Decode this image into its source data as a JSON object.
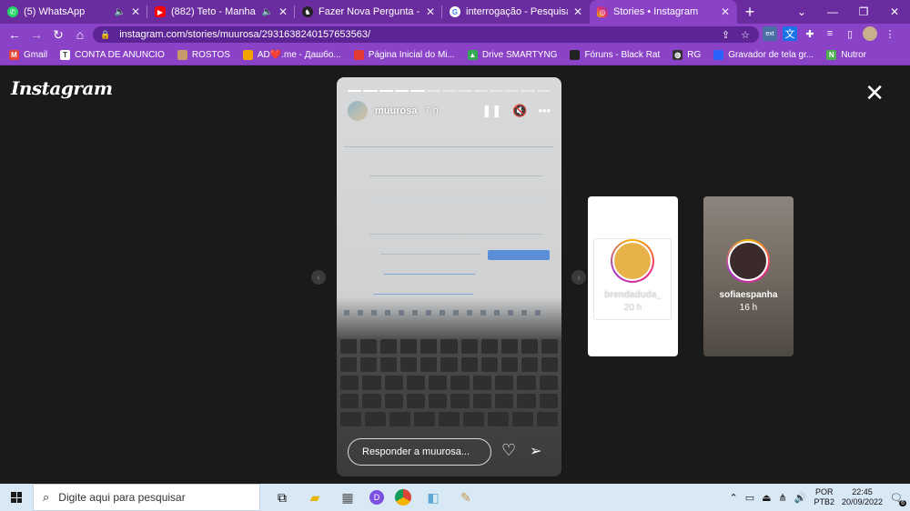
{
  "tabs": [
    {
      "title": "(5) WhatsApp",
      "favicon": "whatsapp-icon",
      "color": "#25d366",
      "muted": true
    },
    {
      "title": "(882) Teto - Manha - You",
      "favicon": "youtube-icon",
      "color": "#ff0000",
      "muted": true
    },
    {
      "title": "Fazer Nova Pergunta - Black",
      "favicon": "blackrat-icon",
      "color": "#222222",
      "muted": false
    },
    {
      "title": "interrogação - Pesquisa Goo",
      "favicon": "google-icon",
      "color": "#ffffff",
      "muted": false
    },
    {
      "title": "Stories • Instagram",
      "favicon": "instagram-icon",
      "color": "#e1306c",
      "muted": false
    }
  ],
  "address": {
    "url": "instagram.com/stories/muurosa/2931638240157653563/"
  },
  "bookmarks": [
    {
      "label": "Gmail",
      "icon": "gmail-icon",
      "color": "#ea4335",
      "glyph": "M"
    },
    {
      "label": "CONTA DE ANUNCIO",
      "icon": "t-icon",
      "color": "#ffffff",
      "glyph": "T"
    },
    {
      "label": "ROSTOS",
      "icon": "avatar-icon",
      "color": "#c99a6b",
      "glyph": ""
    },
    {
      "label": "AD❤️.me - Дашбо...",
      "icon": "ad-icon",
      "color": "#f5a300",
      "glyph": ""
    },
    {
      "label": "Página Inicial do Mi...",
      "icon": "mi-icon",
      "color": "#e53935",
      "glyph": ""
    },
    {
      "label": "Drive SMARTYNG",
      "icon": "drive-icon",
      "color": "#34a853",
      "glyph": "▲"
    },
    {
      "label": "Fóruns - Black Rat",
      "icon": "blackrat-icon",
      "color": "#222222",
      "glyph": ""
    },
    {
      "label": "RG",
      "icon": "globe-icon",
      "color": "#333333",
      "glyph": "◍"
    },
    {
      "label": "Gravador de tela gr...",
      "icon": "recorder-icon",
      "color": "#2962ff",
      "glyph": ""
    },
    {
      "label": "Nutror",
      "icon": "nutror-icon",
      "color": "#4caf50",
      "glyph": "N"
    }
  ],
  "instagram": {
    "logo": "Instagram"
  },
  "story": {
    "user": "muurosa",
    "time": "7 h",
    "reply_placeholder": "Responder a muurosa...",
    "segments_total": 13,
    "segments_done": 5
  },
  "previews": [
    {
      "name": "brendaduda_",
      "time": "20 h",
      "bg": "#ffffff"
    },
    {
      "name": "sofiaespanha",
      "time": "16 h",
      "bg": "#7a7068"
    }
  ],
  "taskbar": {
    "search_placeholder": "Digite aqui para pesquisar",
    "lang_line1": "POR",
    "lang_line2": "PTB2",
    "time": "22:45",
    "date": "20/09/2022",
    "notification_count": "6"
  }
}
